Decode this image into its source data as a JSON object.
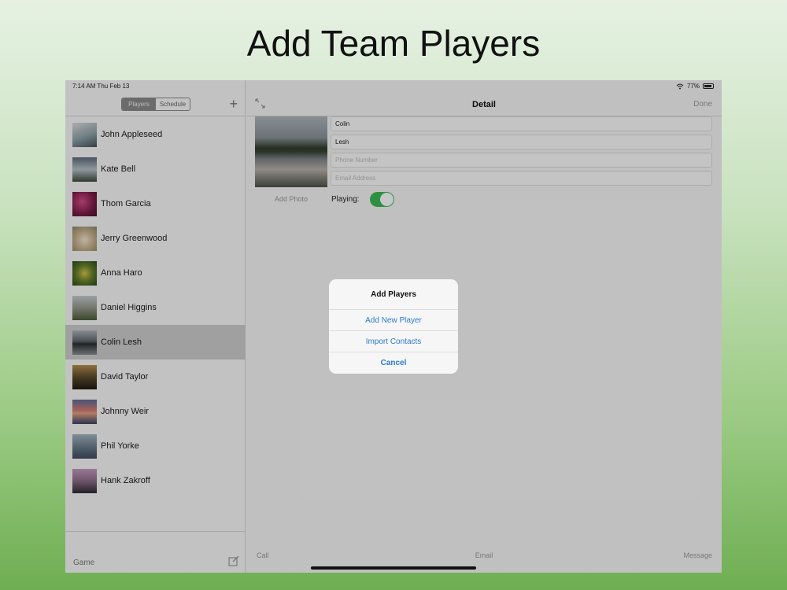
{
  "slide": {
    "title": "Add Team Players"
  },
  "status_bar": {
    "time": "7:14 AM   Thu Feb 13",
    "battery": "77%",
    "wifi_icon": "wifi-icon",
    "battery_icon": "battery-icon"
  },
  "master": {
    "segments": [
      "Players",
      "Schedule"
    ],
    "active_segment": "Players",
    "add_label": "+",
    "players": [
      {
        "name": "John Appleseed",
        "color": "#b7c3c8"
      },
      {
        "name": "Kate Bell",
        "color": "#6b7c8d"
      },
      {
        "name": "Thom Garcia",
        "color": "#a32b5f"
      },
      {
        "name": "Jerry Greenwood",
        "color": "#c9b89a"
      },
      {
        "name": "Anna Haro",
        "color": "#6a8a3a"
      },
      {
        "name": "Daniel Higgins",
        "color": "#8a9278"
      },
      {
        "name": "Colin Lesh",
        "color": "#55585a"
      },
      {
        "name": "David Taylor",
        "color": "#6e5a35"
      },
      {
        "name": "Johnny Weir",
        "color": "#c76c6c"
      },
      {
        "name": "Phil Yorke",
        "color": "#7f95a6"
      },
      {
        "name": "Hank Zakroff",
        "color": "#9b6f8e"
      }
    ],
    "selected_player": "Colin Lesh",
    "bottom_label": "Game",
    "compose_icon": "compose-icon"
  },
  "detail": {
    "title": "Detail",
    "done_label": "Done",
    "expand_icon": "expand-icon",
    "first_name": "Colin",
    "last_name": "Lesh",
    "phone_placeholder": "Phone Number",
    "email_placeholder": "Email Address",
    "add_photo_label": "Add Photo",
    "playing_label": "Playing:",
    "playing": true,
    "toolbar": {
      "call": "Call",
      "email": "Email",
      "message": "Message"
    }
  },
  "alert": {
    "title": "Add Players",
    "buttons": [
      "Add New Player",
      "Import Contacts"
    ],
    "cancel": "Cancel"
  },
  "colors": {
    "accent": "#2b7bd4",
    "toggle_on": "#3cba55"
  }
}
